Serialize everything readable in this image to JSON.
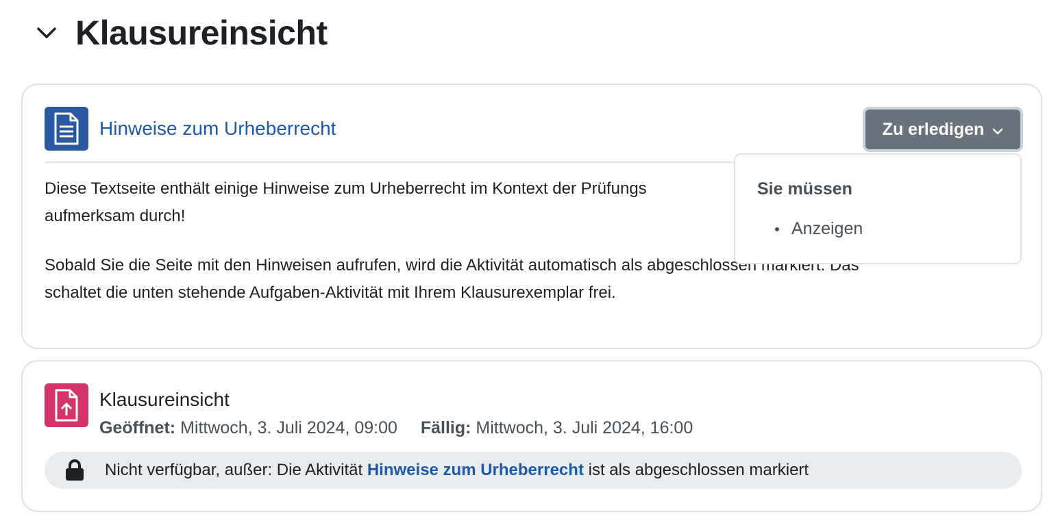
{
  "section": {
    "title": "Klausureinsicht",
    "toggle_icon": "chevron-down-icon"
  },
  "page_activity": {
    "icon": "file-text-icon",
    "icon_color": "#2b5aa3",
    "link_text": "Hinweise zum Urheberrecht",
    "todo_button_label": "Zu erledigen",
    "description_line1": "Diese Textseite enthält einige Hinweise zum Urheberrecht im Kontext der Prüfungs",
    "description_line1_end": "aufmerksam durch!",
    "description_line2": "Sobald Sie die Seite mit den Hinweisen aufrufen, wird die Aktivität automatisch als abgeschlossen markiert. Das",
    "description_line2_end": "schaltet die unten stehende Aufgaben-Aktivität mit Ihrem Klausurexemplar frei.",
    "dropdown": {
      "heading": "Sie müssen",
      "items": [
        "Anzeigen"
      ]
    }
  },
  "assign_activity": {
    "icon": "file-upload-icon",
    "icon_color": "#d6336c",
    "name": "Klausureinsicht",
    "opened_label": "Geöffnet:",
    "opened_value": "Mittwoch, 3. Juli 2024, 09:00",
    "due_label": "Fällig:",
    "due_value": "Mittwoch, 3. Juli 2024, 16:00",
    "restriction_prefix": "Nicht verfügbar, außer: Die Aktivität",
    "restriction_link": "Hinweise zum Urheberrecht",
    "restriction_suffix": "ist als abgeschlossen markiert"
  }
}
